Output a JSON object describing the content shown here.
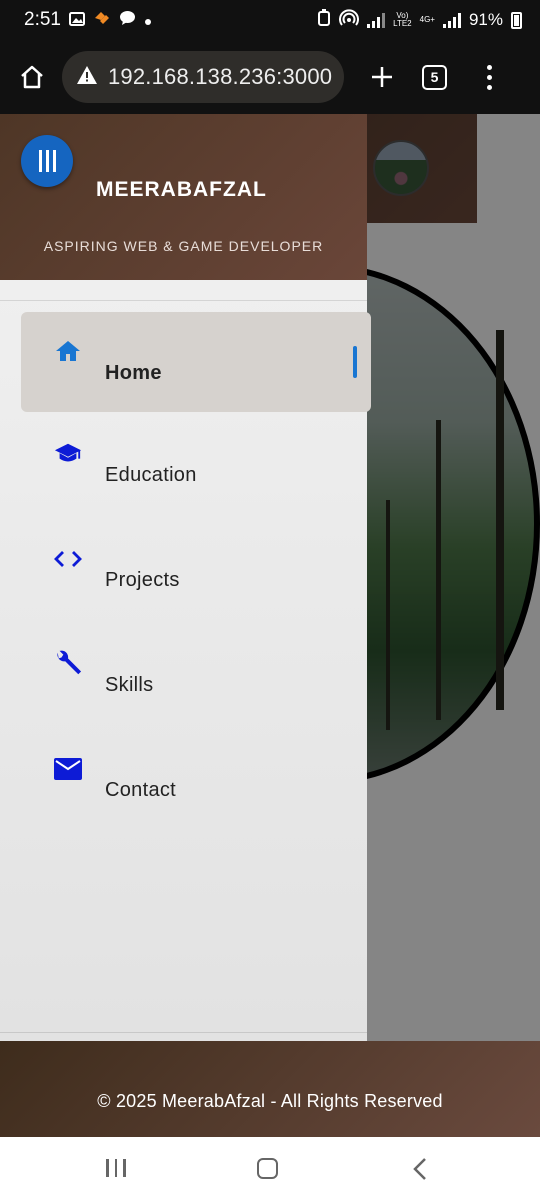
{
  "status_bar": {
    "time": "2:51",
    "battery": "91%",
    "network_top": "Vo)",
    "network_bottom": "LTE2",
    "network_4g": "4G+"
  },
  "browser": {
    "url": "192.168.138.236:3000",
    "tab_count": "5"
  },
  "drawer": {
    "title": "MEERABAFZAL",
    "subtitle": "ASPIRING WEB & GAME DEVELOPER",
    "items": [
      {
        "label": "Home",
        "icon": "home-icon",
        "active": true
      },
      {
        "label": "Education",
        "icon": "graduation-cap-icon",
        "active": false
      },
      {
        "label": "Projects",
        "icon": "code-icon",
        "active": false
      },
      {
        "label": "Skills",
        "icon": "wrench-icon",
        "active": false
      },
      {
        "label": "Contact",
        "icon": "mail-icon",
        "active": false
      }
    ]
  },
  "footer": {
    "text": "© 2025 MeerabAfzal - All Rights Reserved"
  },
  "colors": {
    "accent": "#1565c0",
    "nav_icon": "#0d1bd6",
    "header_brown": "#5a3e30"
  }
}
